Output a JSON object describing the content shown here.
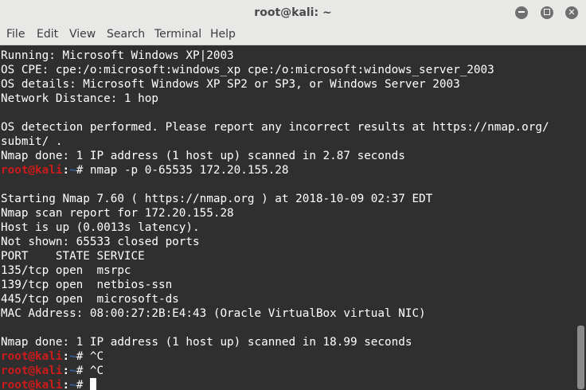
{
  "window": {
    "title": "root@kali: ~"
  },
  "menu": [
    "File",
    "Edit",
    "View",
    "Search",
    "Terminal",
    "Help"
  ],
  "prompt": {
    "user": "root@kali",
    "sep": ":",
    "path": "~",
    "symbol": "# "
  },
  "lines": [
    {
      "type": "output",
      "text": "Running: Microsoft Windows XP|2003"
    },
    {
      "type": "output",
      "text": "OS CPE: cpe:/o:microsoft:windows_xp cpe:/o:microsoft:windows_server_2003"
    },
    {
      "type": "output",
      "text": "OS details: Microsoft Windows XP SP2 or SP3, or Windows Server 2003"
    },
    {
      "type": "output",
      "text": "Network Distance: 1 hop"
    },
    {
      "type": "output",
      "text": ""
    },
    {
      "type": "output",
      "text": "OS detection performed. Please report any incorrect results at https://nmap.org/"
    },
    {
      "type": "output",
      "text": "submit/ ."
    },
    {
      "type": "output",
      "text": "Nmap done: 1 IP address (1 host up) scanned in 2.87 seconds"
    },
    {
      "type": "prompt",
      "text": "nmap -p 0-65535 172.20.155.28"
    },
    {
      "type": "output",
      "text": ""
    },
    {
      "type": "output",
      "text": "Starting Nmap 7.60 ( https://nmap.org ) at 2018-10-09 02:37 EDT"
    },
    {
      "type": "output",
      "text": "Nmap scan report for 172.20.155.28"
    },
    {
      "type": "output",
      "text": "Host is up (0.0013s latency)."
    },
    {
      "type": "output",
      "text": "Not shown: 65533 closed ports"
    },
    {
      "type": "output",
      "text": "PORT    STATE SERVICE"
    },
    {
      "type": "output",
      "text": "135/tcp open  msrpc"
    },
    {
      "type": "output",
      "text": "139/tcp open  netbios-ssn"
    },
    {
      "type": "output",
      "text": "445/tcp open  microsoft-ds"
    },
    {
      "type": "output",
      "text": "MAC Address: 08:00:27:2B:E4:43 (Oracle VirtualBox virtual NIC)"
    },
    {
      "type": "output",
      "text": ""
    },
    {
      "type": "output",
      "text": "Nmap done: 1 IP address (1 host up) scanned in 18.99 seconds"
    },
    {
      "type": "prompt",
      "text": "^C"
    },
    {
      "type": "prompt",
      "text": "^C"
    },
    {
      "type": "prompt",
      "text": "",
      "cursor": true
    }
  ],
  "colors": {
    "background": "#2f2f2f",
    "foreground": "#ffffff",
    "prompt_user": "#cc1b1b",
    "prompt_path": "#3465a4",
    "chrome": "#e8e8e7"
  }
}
